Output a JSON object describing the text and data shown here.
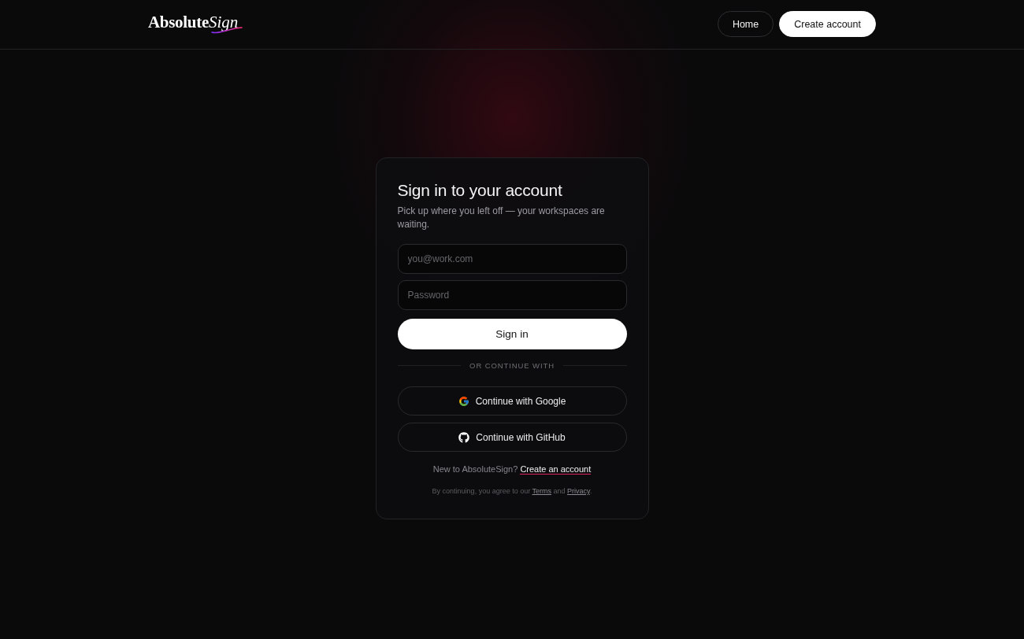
{
  "header": {
    "logo": {
      "word": "Absolute",
      "accent": "Sign"
    },
    "nav": [
      {
        "label": "Home",
        "kind": "outline"
      },
      {
        "label": "Create account",
        "kind": "solid"
      }
    ]
  },
  "card": {
    "title": "Sign in to your account",
    "subtitle": "Pick up where you left off — your workspaces are waiting.",
    "fields": [
      {
        "placeholder": "you@work.com"
      },
      {
        "placeholder": "Password"
      }
    ],
    "submit": "Sign in",
    "divider": "OR CONTINUE WITH",
    "providers": [
      {
        "label": "Continue with Google",
        "kind": "google"
      },
      {
        "label": "Continue with GitHub",
        "kind": "github"
      }
    ],
    "signup": {
      "prompt": "New to AbsoluteSign? ",
      "link": "Create an account"
    },
    "legal": [
      {
        "text": "By continuing, you agree to our ",
        "kind": "text"
      },
      {
        "text": "Terms",
        "kind": "link"
      },
      {
        "text": " and ",
        "kind": "text"
      },
      {
        "text": "Privacy",
        "kind": "link"
      },
      {
        "text": ".",
        "kind": "text"
      }
    ]
  }
}
